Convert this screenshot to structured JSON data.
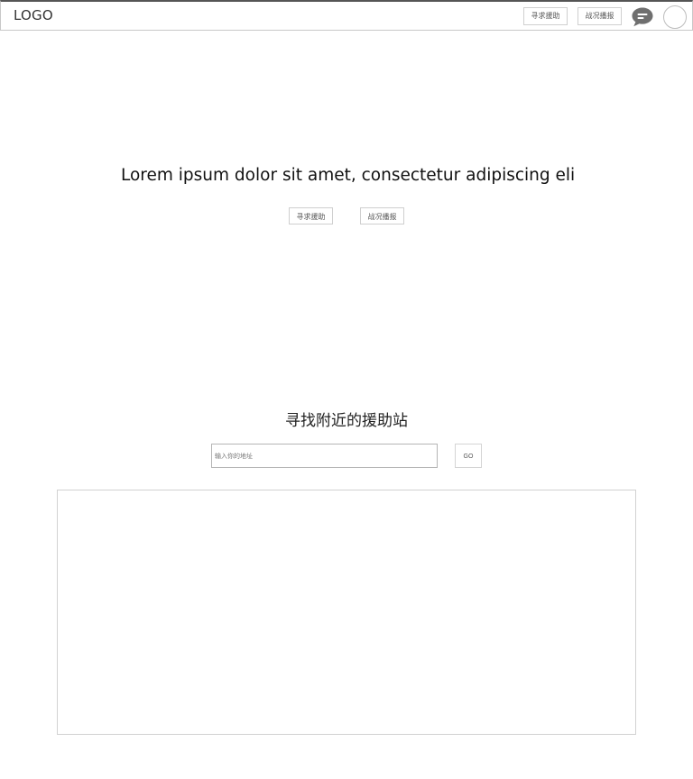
{
  "header": {
    "logo": "LOGO",
    "help_label": "寻求援助",
    "report_label": "战况播报",
    "chat_icon": "chat-bubble-icon",
    "avatar": "user-avatar"
  },
  "hero": {
    "title": "Lorem ipsum dolor sit amet, consectetur adipiscing elit",
    "help_label": "寻求援助",
    "report_label": "战况播报"
  },
  "finder": {
    "title": "寻找附近的援助站",
    "input_placeholder": "输入你的地址",
    "go_label": "GO"
  },
  "colors": {
    "chat_icon": "#6f6f6f",
    "border": "#cfcfcf"
  }
}
